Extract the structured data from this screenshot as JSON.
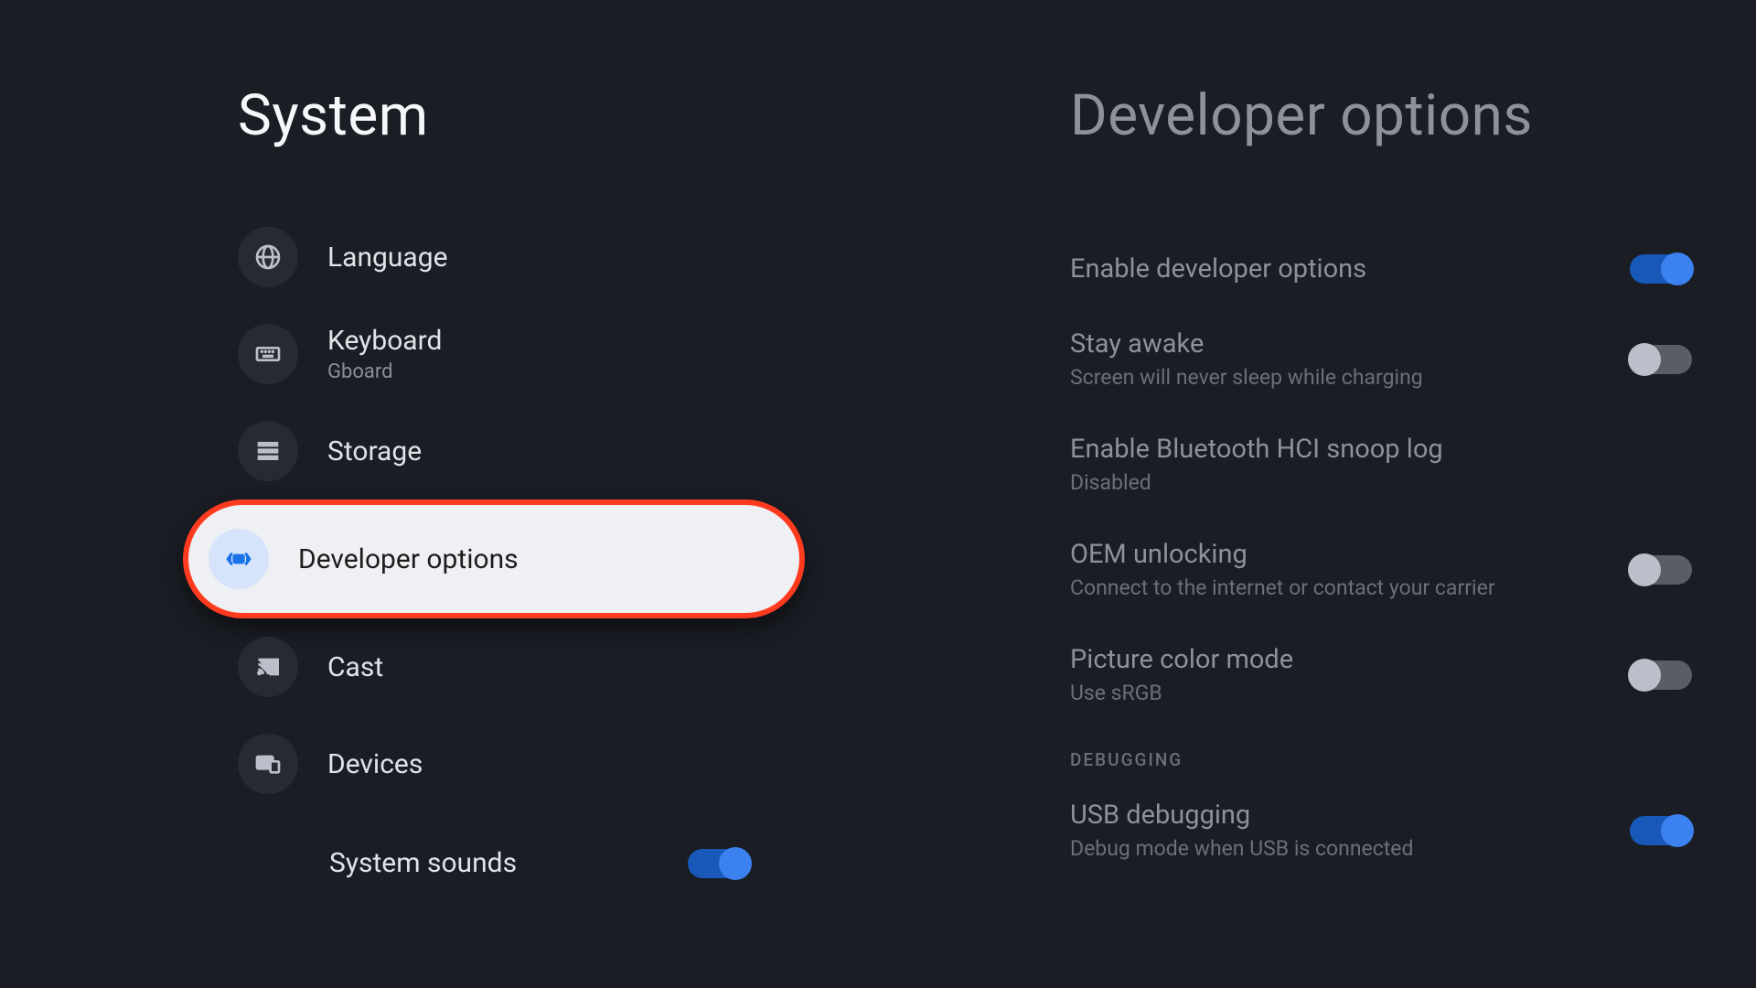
{
  "left": {
    "title": "System",
    "items": [
      {
        "icon": "globe",
        "label": "Language",
        "sublabel": null
      },
      {
        "icon": "keyboard",
        "label": "Keyboard",
        "sublabel": "Gboard"
      },
      {
        "icon": "storage",
        "label": "Storage",
        "sublabel": null
      },
      {
        "icon": "devopts",
        "label": "Developer options",
        "sublabel": null,
        "selected": true
      },
      {
        "icon": "cast",
        "label": "Cast",
        "sublabel": null
      },
      {
        "icon": "devices",
        "label": "Devices",
        "sublabel": null
      }
    ],
    "system_sounds": {
      "label": "System sounds",
      "on": true
    }
  },
  "right": {
    "title": "Developer options",
    "options": [
      {
        "title": "Enable developer options",
        "sub": null,
        "toggle": "on"
      },
      {
        "title": "Stay awake",
        "sub": "Screen will never sleep while charging",
        "toggle": "off"
      },
      {
        "title": "Enable Bluetooth HCI snoop log",
        "sub": "Disabled",
        "toggle": null
      },
      {
        "title": "OEM unlocking",
        "sub": "Connect to the internet or contact your carrier",
        "toggle": "off"
      },
      {
        "title": "Picture color mode",
        "sub": "Use sRGB",
        "toggle": "off"
      }
    ],
    "section_header": "DEBUGGING",
    "debugging": [
      {
        "title": "USB debugging",
        "sub": "Debug mode when USB is connected",
        "toggle": "on"
      }
    ]
  }
}
